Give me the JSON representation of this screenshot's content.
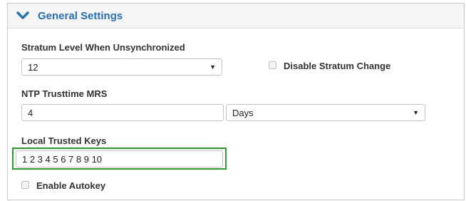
{
  "header": {
    "title": "General Settings",
    "chevron_icon": "chevron-down-icon",
    "accent": "#2a6fb0"
  },
  "stratum": {
    "label": "Stratum Level When Unsynchronized",
    "selected": "12"
  },
  "disable_stratum_change": {
    "label": "Disable Stratum Change",
    "checked": false
  },
  "ntp_trusttime": {
    "label": "NTP Trusttime MRS",
    "value": "4",
    "unit_selected": "Days"
  },
  "local_trusted_keys": {
    "label": "Local Trusted Keys",
    "value": "1 2 3 4 5 6 7 8 9 10",
    "highlight_color": "#2c9a2c"
  },
  "enable_autokey": {
    "label": "Enable Autokey",
    "checked": false
  }
}
